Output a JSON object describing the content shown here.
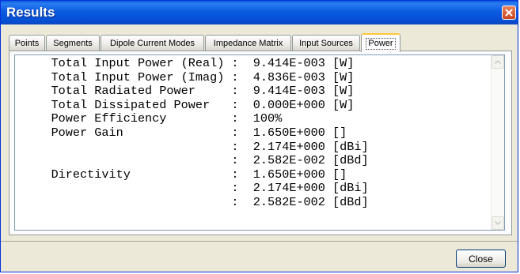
{
  "window": {
    "title": "Results",
    "close_icon": "close-icon"
  },
  "tabs": [
    {
      "label": "Points",
      "active": false
    },
    {
      "label": "Segments",
      "active": false
    },
    {
      "label": "Dipole Current Modes",
      "active": false
    },
    {
      "label": "Impedance Matrix",
      "active": false
    },
    {
      "label": "Input Sources",
      "active": false
    },
    {
      "label": "Power",
      "active": true
    }
  ],
  "results_lines": [
    "     Total Input Power (Real) :  9.414E-003 [W]",
    "     Total Input Power (Imag) :  4.836E-003 [W]",
    "     Total Radiated Power     :  9.414E-003 [W]",
    "     Total Dissipated Power   :  0.000E+000 [W]",
    "     Power Efficiency         :  100%",
    "     Power Gain               :  1.650E+000 []",
    "                              :  2.174E+000 [dBi]",
    "                              :  2.582E-002 [dBd]",
    "     Directivity              :  1.650E+000 []",
    "                              :  2.174E+000 [dBi]",
    "                              :  2.582E-002 [dBd]"
  ],
  "scrollbar": {
    "up_icon": "scroll-up-arrow-icon",
    "down_icon": "scroll-down-arrow-icon"
  },
  "footer": {
    "close_label": "Close"
  },
  "colors": {
    "titlebar": "#0b5be0",
    "window_bg": "#ece9d8",
    "active_tab_highlight": "#ffc83c"
  }
}
